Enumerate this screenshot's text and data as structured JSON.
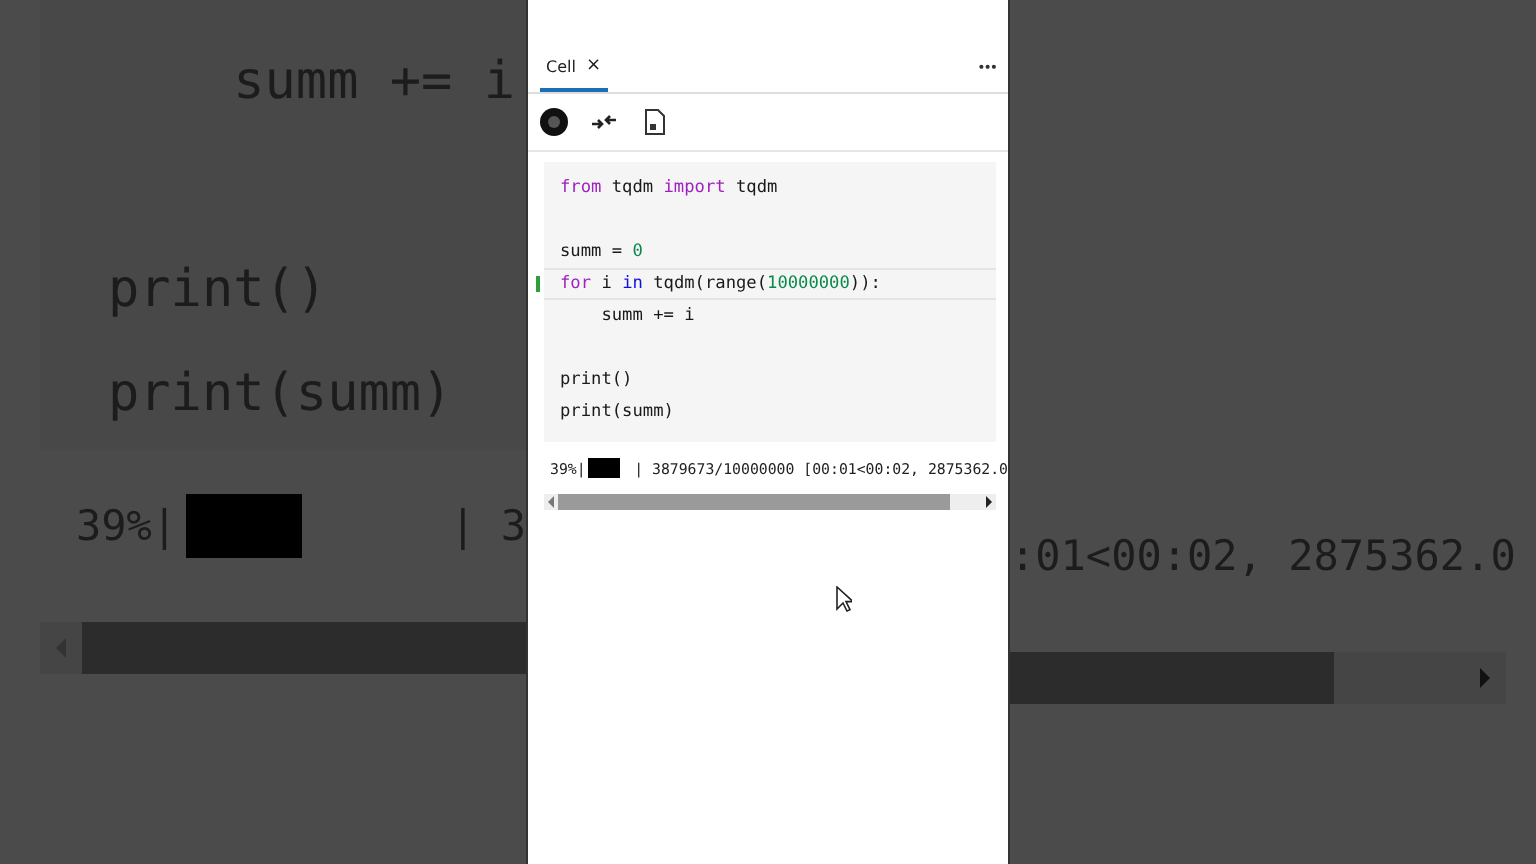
{
  "backdrop": {
    "left": {
      "code_lines": [
        "    summ += i",
        "print()",
        "print(summ)"
      ],
      "progress": {
        "percent": "39%|",
        "tail": "| 3"
      }
    },
    "right": {
      "output": ":01<00:02, 2875362.0"
    }
  },
  "panel": {
    "tabs": [
      {
        "label": "Cell",
        "close": "×",
        "selected": true
      }
    ],
    "more": "•••",
    "cell": {
      "lines": [
        {
          "current": false,
          "tokens": [
            {
              "kind": "keyword",
              "text": "from"
            },
            {
              "kind": "plain",
              "text": " tqdm "
            },
            {
              "kind": "keyword",
              "text": "import"
            },
            {
              "kind": "plain",
              "text": " tqdm"
            }
          ]
        },
        {
          "current": false
        },
        {
          "current": false,
          "tokens": [
            {
              "kind": "plain",
              "text": "summ = "
            },
            {
              "kind": "number",
              "text": "0"
            }
          ]
        },
        {
          "current": true,
          "tokens": [
            {
              "kind": "keyword",
              "text": "for"
            },
            {
              "kind": "plain",
              "text": " i "
            },
            {
              "kind": "operator",
              "text": "in"
            },
            {
              "kind": "plain",
              "text": " tqdm(range("
            },
            {
              "kind": "number",
              "text": "10000000"
            },
            {
              "kind": "plain",
              "text": ")):"
            }
          ]
        },
        {
          "current": false,
          "tokens": [
            {
              "kind": "plain",
              "text": "    summ += i"
            }
          ]
        },
        {
          "current": false
        },
        {
          "current": false,
          "tokens": [
            {
              "kind": "plain",
              "text": "print()"
            }
          ]
        },
        {
          "current": false,
          "tokens": [
            {
              "kind": "plain",
              "text": "print(summ)"
            }
          ]
        }
      ]
    },
    "output": {
      "percent": "39%|",
      "tail": "| 3879673/10000000 [00:01<00:02, 2875362.0"
    }
  }
}
